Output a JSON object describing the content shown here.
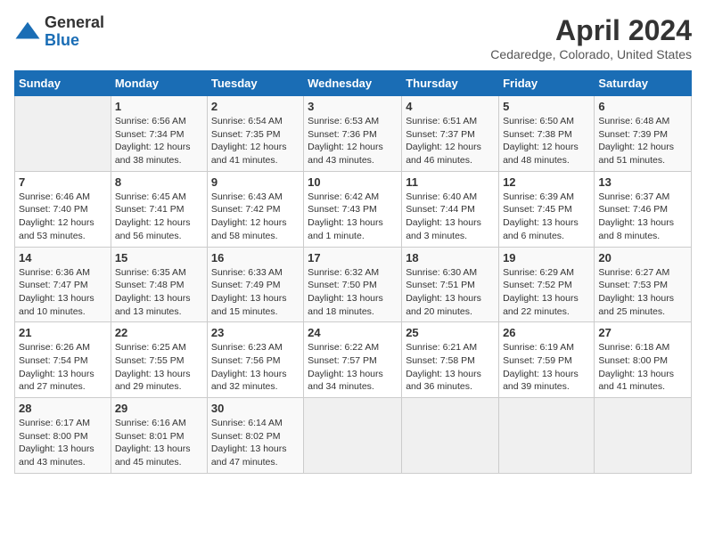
{
  "header": {
    "logo_general": "General",
    "logo_blue": "Blue",
    "month_year": "April 2024",
    "location": "Cedaredge, Colorado, United States"
  },
  "weekdays": [
    "Sunday",
    "Monday",
    "Tuesday",
    "Wednesday",
    "Thursday",
    "Friday",
    "Saturday"
  ],
  "weeks": [
    [
      {
        "day": "",
        "sunrise": "",
        "sunset": "",
        "daylight": ""
      },
      {
        "day": "1",
        "sunrise": "Sunrise: 6:56 AM",
        "sunset": "Sunset: 7:34 PM",
        "daylight": "Daylight: 12 hours and 38 minutes."
      },
      {
        "day": "2",
        "sunrise": "Sunrise: 6:54 AM",
        "sunset": "Sunset: 7:35 PM",
        "daylight": "Daylight: 12 hours and 41 minutes."
      },
      {
        "day": "3",
        "sunrise": "Sunrise: 6:53 AM",
        "sunset": "Sunset: 7:36 PM",
        "daylight": "Daylight: 12 hours and 43 minutes."
      },
      {
        "day": "4",
        "sunrise": "Sunrise: 6:51 AM",
        "sunset": "Sunset: 7:37 PM",
        "daylight": "Daylight: 12 hours and 46 minutes."
      },
      {
        "day": "5",
        "sunrise": "Sunrise: 6:50 AM",
        "sunset": "Sunset: 7:38 PM",
        "daylight": "Daylight: 12 hours and 48 minutes."
      },
      {
        "day": "6",
        "sunrise": "Sunrise: 6:48 AM",
        "sunset": "Sunset: 7:39 PM",
        "daylight": "Daylight: 12 hours and 51 minutes."
      }
    ],
    [
      {
        "day": "7",
        "sunrise": "Sunrise: 6:46 AM",
        "sunset": "Sunset: 7:40 PM",
        "daylight": "Daylight: 12 hours and 53 minutes."
      },
      {
        "day": "8",
        "sunrise": "Sunrise: 6:45 AM",
        "sunset": "Sunset: 7:41 PM",
        "daylight": "Daylight: 12 hours and 56 minutes."
      },
      {
        "day": "9",
        "sunrise": "Sunrise: 6:43 AM",
        "sunset": "Sunset: 7:42 PM",
        "daylight": "Daylight: 12 hours and 58 minutes."
      },
      {
        "day": "10",
        "sunrise": "Sunrise: 6:42 AM",
        "sunset": "Sunset: 7:43 PM",
        "daylight": "Daylight: 13 hours and 1 minute."
      },
      {
        "day": "11",
        "sunrise": "Sunrise: 6:40 AM",
        "sunset": "Sunset: 7:44 PM",
        "daylight": "Daylight: 13 hours and 3 minutes."
      },
      {
        "day": "12",
        "sunrise": "Sunrise: 6:39 AM",
        "sunset": "Sunset: 7:45 PM",
        "daylight": "Daylight: 13 hours and 6 minutes."
      },
      {
        "day": "13",
        "sunrise": "Sunrise: 6:37 AM",
        "sunset": "Sunset: 7:46 PM",
        "daylight": "Daylight: 13 hours and 8 minutes."
      }
    ],
    [
      {
        "day": "14",
        "sunrise": "Sunrise: 6:36 AM",
        "sunset": "Sunset: 7:47 PM",
        "daylight": "Daylight: 13 hours and 10 minutes."
      },
      {
        "day": "15",
        "sunrise": "Sunrise: 6:35 AM",
        "sunset": "Sunset: 7:48 PM",
        "daylight": "Daylight: 13 hours and 13 minutes."
      },
      {
        "day": "16",
        "sunrise": "Sunrise: 6:33 AM",
        "sunset": "Sunset: 7:49 PM",
        "daylight": "Daylight: 13 hours and 15 minutes."
      },
      {
        "day": "17",
        "sunrise": "Sunrise: 6:32 AM",
        "sunset": "Sunset: 7:50 PM",
        "daylight": "Daylight: 13 hours and 18 minutes."
      },
      {
        "day": "18",
        "sunrise": "Sunrise: 6:30 AM",
        "sunset": "Sunset: 7:51 PM",
        "daylight": "Daylight: 13 hours and 20 minutes."
      },
      {
        "day": "19",
        "sunrise": "Sunrise: 6:29 AM",
        "sunset": "Sunset: 7:52 PM",
        "daylight": "Daylight: 13 hours and 22 minutes."
      },
      {
        "day": "20",
        "sunrise": "Sunrise: 6:27 AM",
        "sunset": "Sunset: 7:53 PM",
        "daylight": "Daylight: 13 hours and 25 minutes."
      }
    ],
    [
      {
        "day": "21",
        "sunrise": "Sunrise: 6:26 AM",
        "sunset": "Sunset: 7:54 PM",
        "daylight": "Daylight: 13 hours and 27 minutes."
      },
      {
        "day": "22",
        "sunrise": "Sunrise: 6:25 AM",
        "sunset": "Sunset: 7:55 PM",
        "daylight": "Daylight: 13 hours and 29 minutes."
      },
      {
        "day": "23",
        "sunrise": "Sunrise: 6:23 AM",
        "sunset": "Sunset: 7:56 PM",
        "daylight": "Daylight: 13 hours and 32 minutes."
      },
      {
        "day": "24",
        "sunrise": "Sunrise: 6:22 AM",
        "sunset": "Sunset: 7:57 PM",
        "daylight": "Daylight: 13 hours and 34 minutes."
      },
      {
        "day": "25",
        "sunrise": "Sunrise: 6:21 AM",
        "sunset": "Sunset: 7:58 PM",
        "daylight": "Daylight: 13 hours and 36 minutes."
      },
      {
        "day": "26",
        "sunrise": "Sunrise: 6:19 AM",
        "sunset": "Sunset: 7:59 PM",
        "daylight": "Daylight: 13 hours and 39 minutes."
      },
      {
        "day": "27",
        "sunrise": "Sunrise: 6:18 AM",
        "sunset": "Sunset: 8:00 PM",
        "daylight": "Daylight: 13 hours and 41 minutes."
      }
    ],
    [
      {
        "day": "28",
        "sunrise": "Sunrise: 6:17 AM",
        "sunset": "Sunset: 8:00 PM",
        "daylight": "Daylight: 13 hours and 43 minutes."
      },
      {
        "day": "29",
        "sunrise": "Sunrise: 6:16 AM",
        "sunset": "Sunset: 8:01 PM",
        "daylight": "Daylight: 13 hours and 45 minutes."
      },
      {
        "day": "30",
        "sunrise": "Sunrise: 6:14 AM",
        "sunset": "Sunset: 8:02 PM",
        "daylight": "Daylight: 13 hours and 47 minutes."
      },
      {
        "day": "",
        "sunrise": "",
        "sunset": "",
        "daylight": ""
      },
      {
        "day": "",
        "sunrise": "",
        "sunset": "",
        "daylight": ""
      },
      {
        "day": "",
        "sunrise": "",
        "sunset": "",
        "daylight": ""
      },
      {
        "day": "",
        "sunrise": "",
        "sunset": "",
        "daylight": ""
      }
    ]
  ]
}
